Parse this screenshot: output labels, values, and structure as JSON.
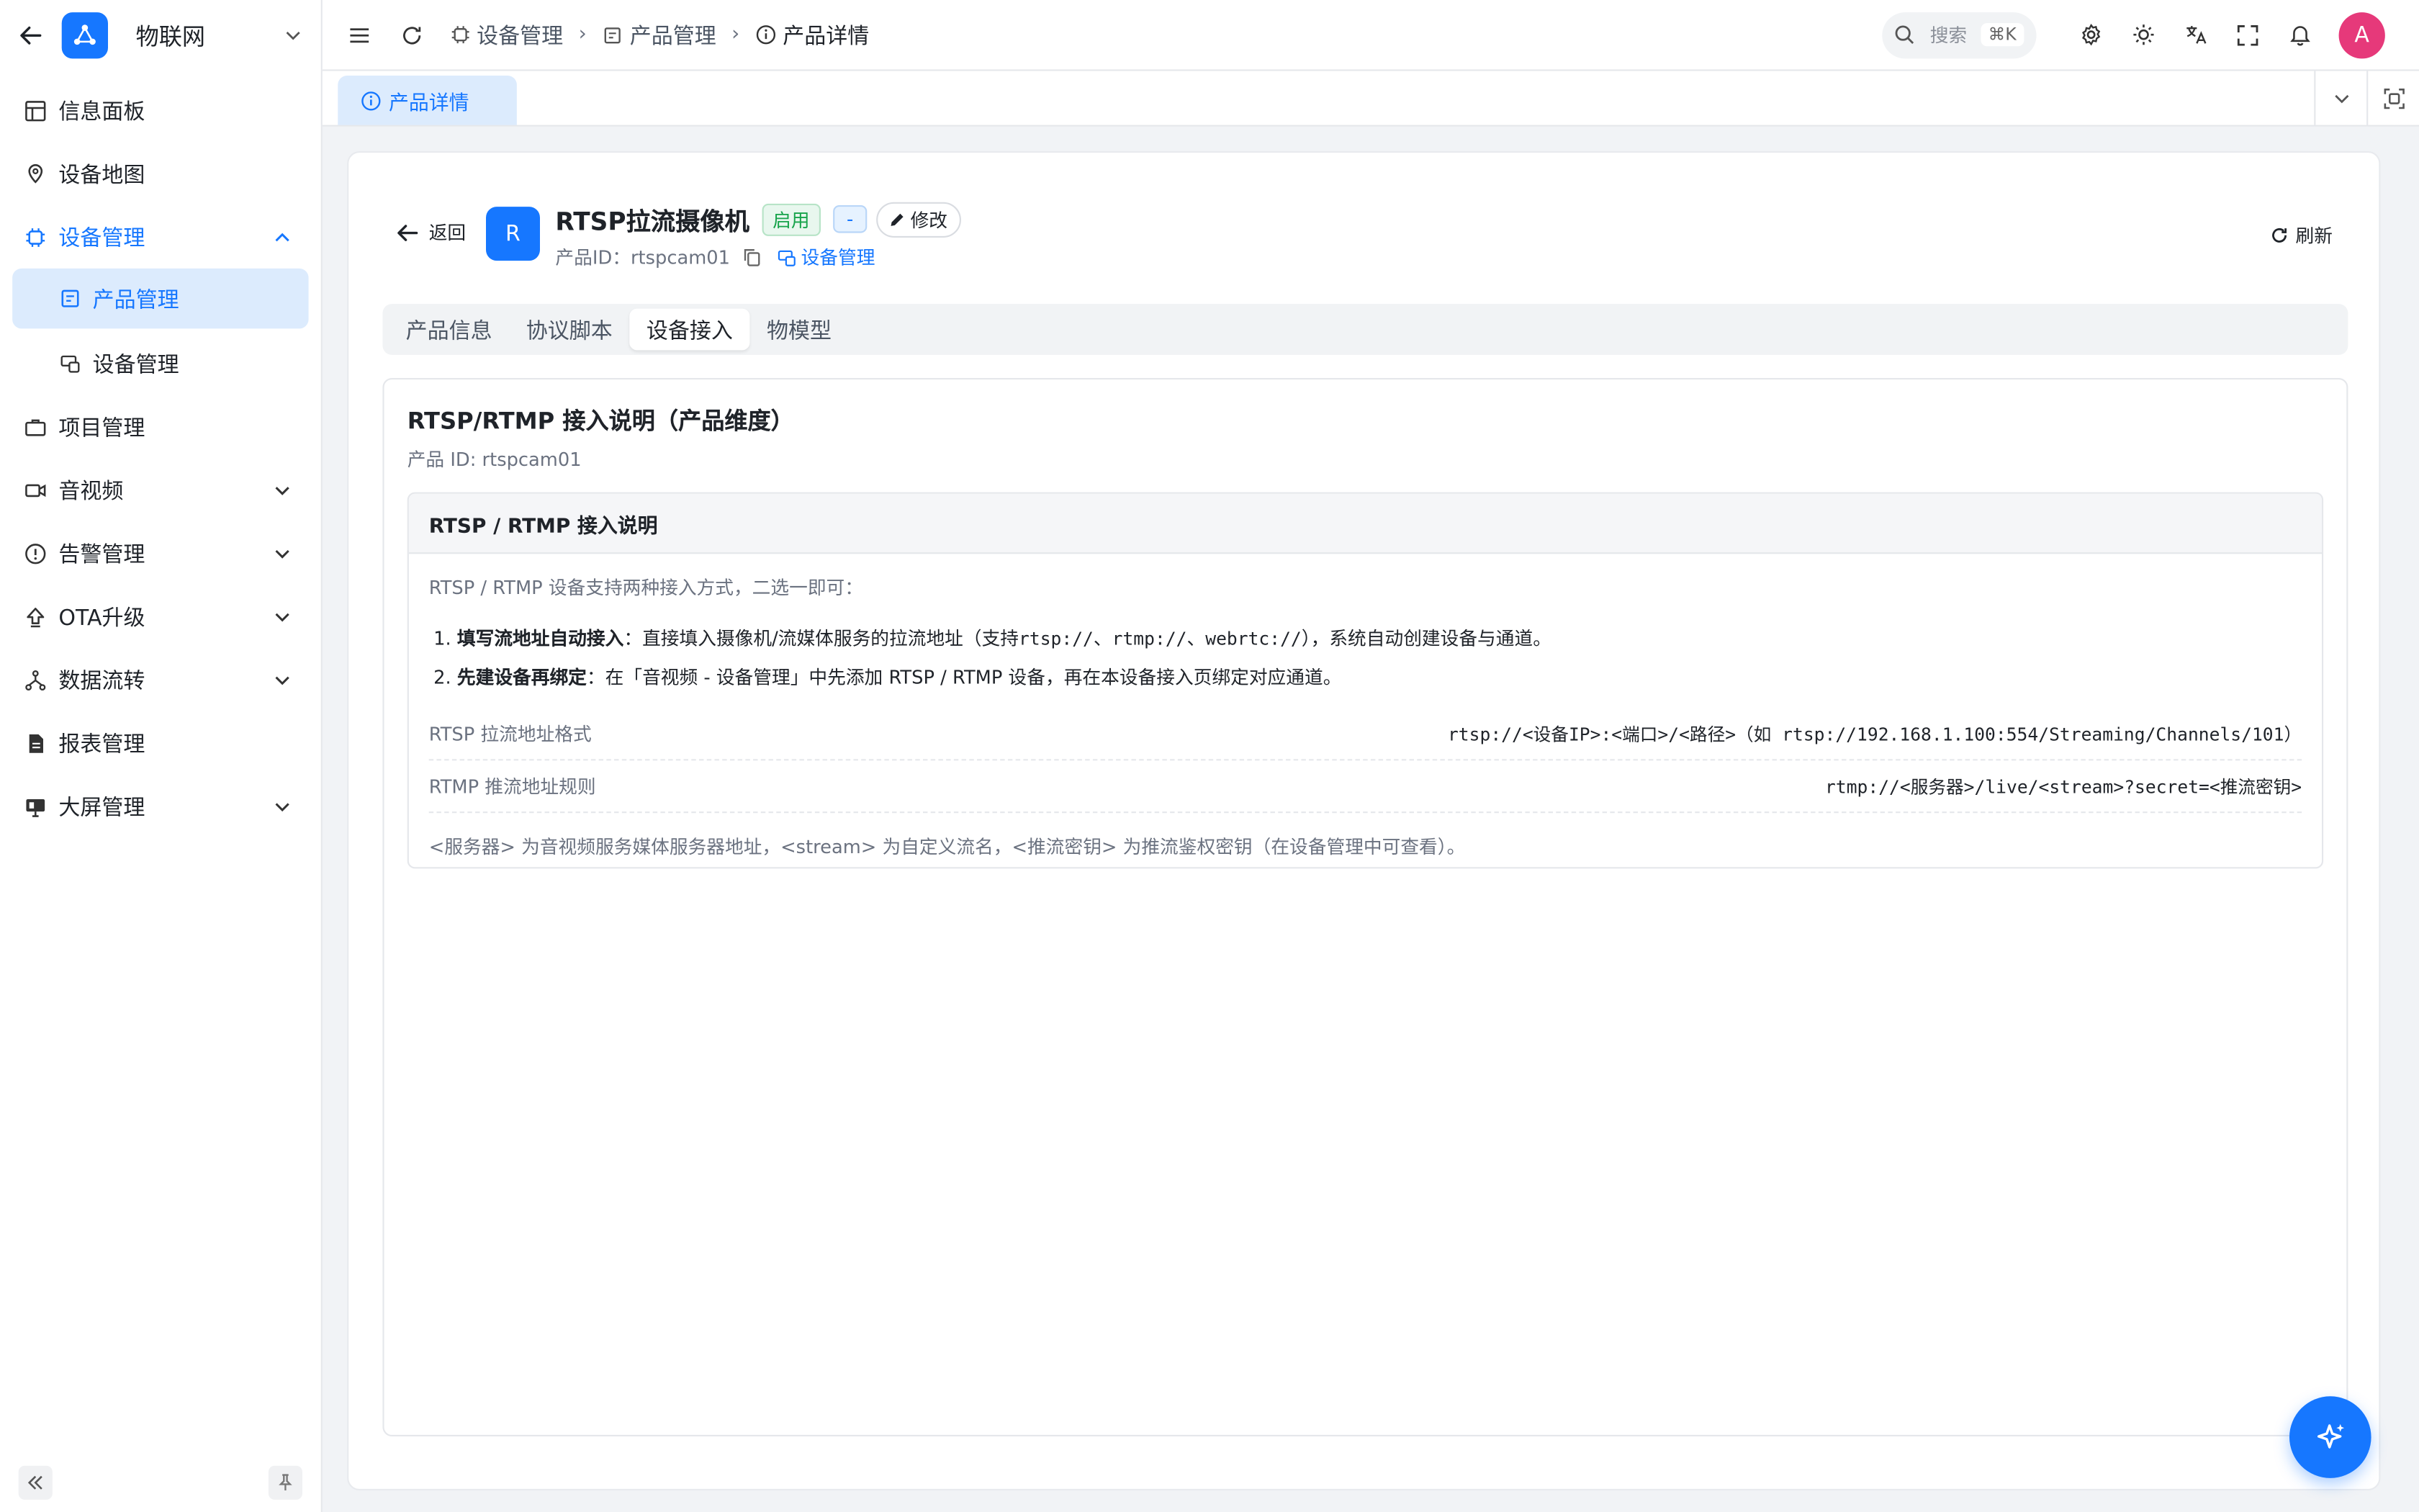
{
  "app": {
    "name": "物联网"
  },
  "sidebar": {
    "items": [
      {
        "label": "信息面板",
        "icon": "dashboard-icon"
      },
      {
        "label": "设备地图",
        "icon": "map-icon"
      },
      {
        "label": "设备管理",
        "icon": "chip-icon",
        "expanded": true
      },
      {
        "label": "项目管理",
        "icon": "briefcase-icon"
      },
      {
        "label": "音视频",
        "icon": "video-icon"
      },
      {
        "label": "告警管理",
        "icon": "alert-icon"
      },
      {
        "label": "OTA升级",
        "icon": "upgrade-icon"
      },
      {
        "label": "数据流转",
        "icon": "flow-icon"
      },
      {
        "label": "报表管理",
        "icon": "report-icon"
      },
      {
        "label": "大屏管理",
        "icon": "monitor-icon"
      }
    ],
    "subitems": [
      {
        "label": "产品管理",
        "selected": true
      },
      {
        "label": "设备管理",
        "selected": false
      }
    ]
  },
  "header": {
    "breadcrumbs": [
      "设备管理",
      "产品管理",
      "产品详情"
    ],
    "search_placeholder": "搜索",
    "search_shortcut": "⌘K",
    "avatar_letter": "A"
  },
  "tabbar": {
    "active_tab": "产品详情"
  },
  "product": {
    "back_label": "返回",
    "avatar_letter": "R",
    "name": "RTSP拉流摄像机",
    "status_tag": "启用",
    "secondary_tag": "-",
    "edit_label": "修改",
    "id_label": "产品ID：rtspcam01",
    "link_label": "设备管理",
    "refresh_label": "刷新"
  },
  "tabs": [
    {
      "label": "产品信息",
      "active": false
    },
    {
      "label": "协议脚本",
      "active": false
    },
    {
      "label": "设备接入",
      "active": true
    },
    {
      "label": "物模型",
      "active": false
    }
  ],
  "panel": {
    "title": "RTSP/RTMP 接入说明（产品维度）",
    "subtitle": "产品 ID: rtspcam01",
    "section_title": "RTSP / RTMP 接入说明",
    "intro": "RTSP / RTMP 设备支持两种接入方式，二选一即可：",
    "steps": [
      {
        "num": "1.",
        "bold": "填写流地址自动接入",
        "pre": "：直接填入摄像机/流媒体服务的拉流地址（支持 ",
        "code1": "rtsp://",
        "sep1": "、",
        "code2": "rtmp://",
        "sep2": "、",
        "code3": "webrtc://",
        "post": "），系统自动创建设备与通道。"
      },
      {
        "num": "2.",
        "bold": "先建设备再绑定",
        "text": "：在「音视频 - 设备管理」中先添加 RTSP / RTMP 设备，再在本设备接入页绑定对应通道。"
      }
    ],
    "rows": [
      {
        "key": "RTSP 拉流地址格式",
        "value": "rtsp://<设备IP>:<端口>/<路径>（如 rtsp://192.168.1.100:554/Streaming/Channels/101）"
      },
      {
        "key": "RTMP 推流地址规则",
        "value": "rtmp://<服务器>/live/<stream>?secret=<推流密钥>"
      }
    ],
    "note": "<服务器> 为音视频服务媒体服务器地址，<stream> 为自定义流名，<推流密钥> 为推流鉴权密钥（在设备管理中可查看）。"
  },
  "colors": {
    "accent": "#1677ff",
    "avatar": "#e6397a",
    "success": "#16a34a"
  }
}
